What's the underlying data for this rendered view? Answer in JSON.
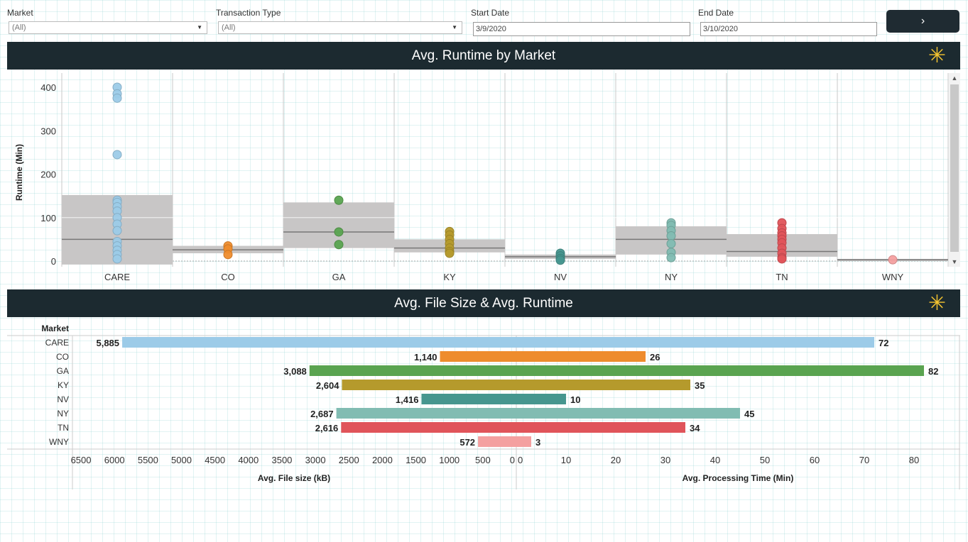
{
  "filters": {
    "market": {
      "label": "Market",
      "value": "(All)"
    },
    "transaction_type": {
      "label": "Transaction Type",
      "value": "(All)"
    },
    "start_date": {
      "label": "Start Date",
      "value": "3/9/2020"
    },
    "end_date": {
      "label": "End Date",
      "value": "3/10/2020"
    },
    "next_button": {
      "icon": "chevron-right-icon",
      "glyph": "›"
    }
  },
  "banners": {
    "runtime": {
      "title": "Avg. Runtime by Market",
      "icon": "asterisk-icon",
      "glyph": "✳"
    },
    "filesize": {
      "title": "Avg. File Size & Avg. Runtime",
      "icon": "asterisk-icon",
      "glyph": "✳"
    }
  },
  "colors": {
    "header_bg": "#1c2a30",
    "accent_star": "#f2c230",
    "CARE": "#9ccbe8",
    "CO": "#ee8c2d",
    "GA": "#5aa450",
    "KY": "#b59a2c",
    "NV": "#46968f",
    "NY": "#81bcb2",
    "TN": "#e0545a",
    "WNY": "#f4a0a0",
    "box": "#c8c6c6"
  },
  "chart_data": [
    {
      "type": "scatter",
      "title": "Avg. Runtime by Market",
      "ylabel": "Runtime (Min)",
      "ylim": [
        -8,
        420
      ],
      "yticks": [
        0,
        100,
        200,
        300,
        400
      ],
      "categories": [
        "CARE",
        "CO",
        "GA",
        "KY",
        "NV",
        "NY",
        "TN",
        "WNY"
      ],
      "series": [
        {
          "category": "CARE",
          "points": [
            400,
            385,
            375,
            245,
            140,
            135,
            125,
            115,
            100,
            85,
            70,
            45,
            35,
            25,
            15,
            5
          ],
          "box": [
            -8,
            152
          ],
          "median": 50
        },
        {
          "category": "CO",
          "points": [
            35,
            28,
            15
          ],
          "box": [
            18,
            35
          ],
          "median": 26
        },
        {
          "category": "GA",
          "points": [
            140,
            67,
            38
          ],
          "box": [
            30,
            135
          ],
          "median": 67
        },
        {
          "category": "KY",
          "points": [
            68,
            60,
            50,
            40,
            30,
            22,
            18
          ],
          "box": [
            20,
            50
          ],
          "median": 30
        },
        {
          "category": "NV",
          "points": [
            18,
            12,
            6,
            2
          ],
          "box": [
            5,
            15
          ],
          "median": 10
        },
        {
          "category": "NY",
          "points": [
            88,
            82,
            70,
            58,
            40,
            20,
            8
          ],
          "box": [
            15,
            80
          ],
          "median": 50
        },
        {
          "category": "TN",
          "points": [
            88,
            75,
            65,
            58,
            50,
            42,
            30,
            18,
            8,
            5
          ],
          "box": [
            10,
            62
          ],
          "median": 22
        },
        {
          "category": "WNY",
          "points": [
            3
          ],
          "box": [
            0,
            5
          ],
          "median": 3
        }
      ]
    },
    {
      "type": "bar",
      "title": "Avg. File Size & Avg. Runtime",
      "row_header": "Market",
      "categories": [
        "CARE",
        "CO",
        "GA",
        "KY",
        "NV",
        "NY",
        "TN",
        "WNY"
      ],
      "series": [
        {
          "name": "Avg. File size (kB)",
          "values": [
            5885,
            1140,
            3088,
            2604,
            1416,
            2687,
            2616,
            572
          ],
          "labels": [
            "5,885",
            "1,140",
            "3,088",
            "2,604",
            "1,416",
            "2,687",
            "2,616",
            "572"
          ]
        },
        {
          "name": "Avg. Processing Time (Min)",
          "values": [
            72,
            26,
            82,
            35,
            10,
            45,
            34,
            3
          ],
          "labels": [
            "72",
            "26",
            "82",
            "35",
            "10",
            "45",
            "34",
            "3"
          ]
        }
      ],
      "left_axis": {
        "label": "Avg. File size (kB)",
        "range": [
          0,
          6500
        ],
        "ticks": [
          6500,
          6000,
          5500,
          5000,
          4500,
          4000,
          3500,
          3000,
          2500,
          2000,
          1500,
          1000,
          500,
          0
        ]
      },
      "right_axis": {
        "label": "Avg. Processing Time (Min)",
        "range": [
          0,
          90
        ],
        "ticks": [
          0,
          10,
          20,
          30,
          40,
          50,
          60,
          70,
          80
        ]
      }
    }
  ]
}
